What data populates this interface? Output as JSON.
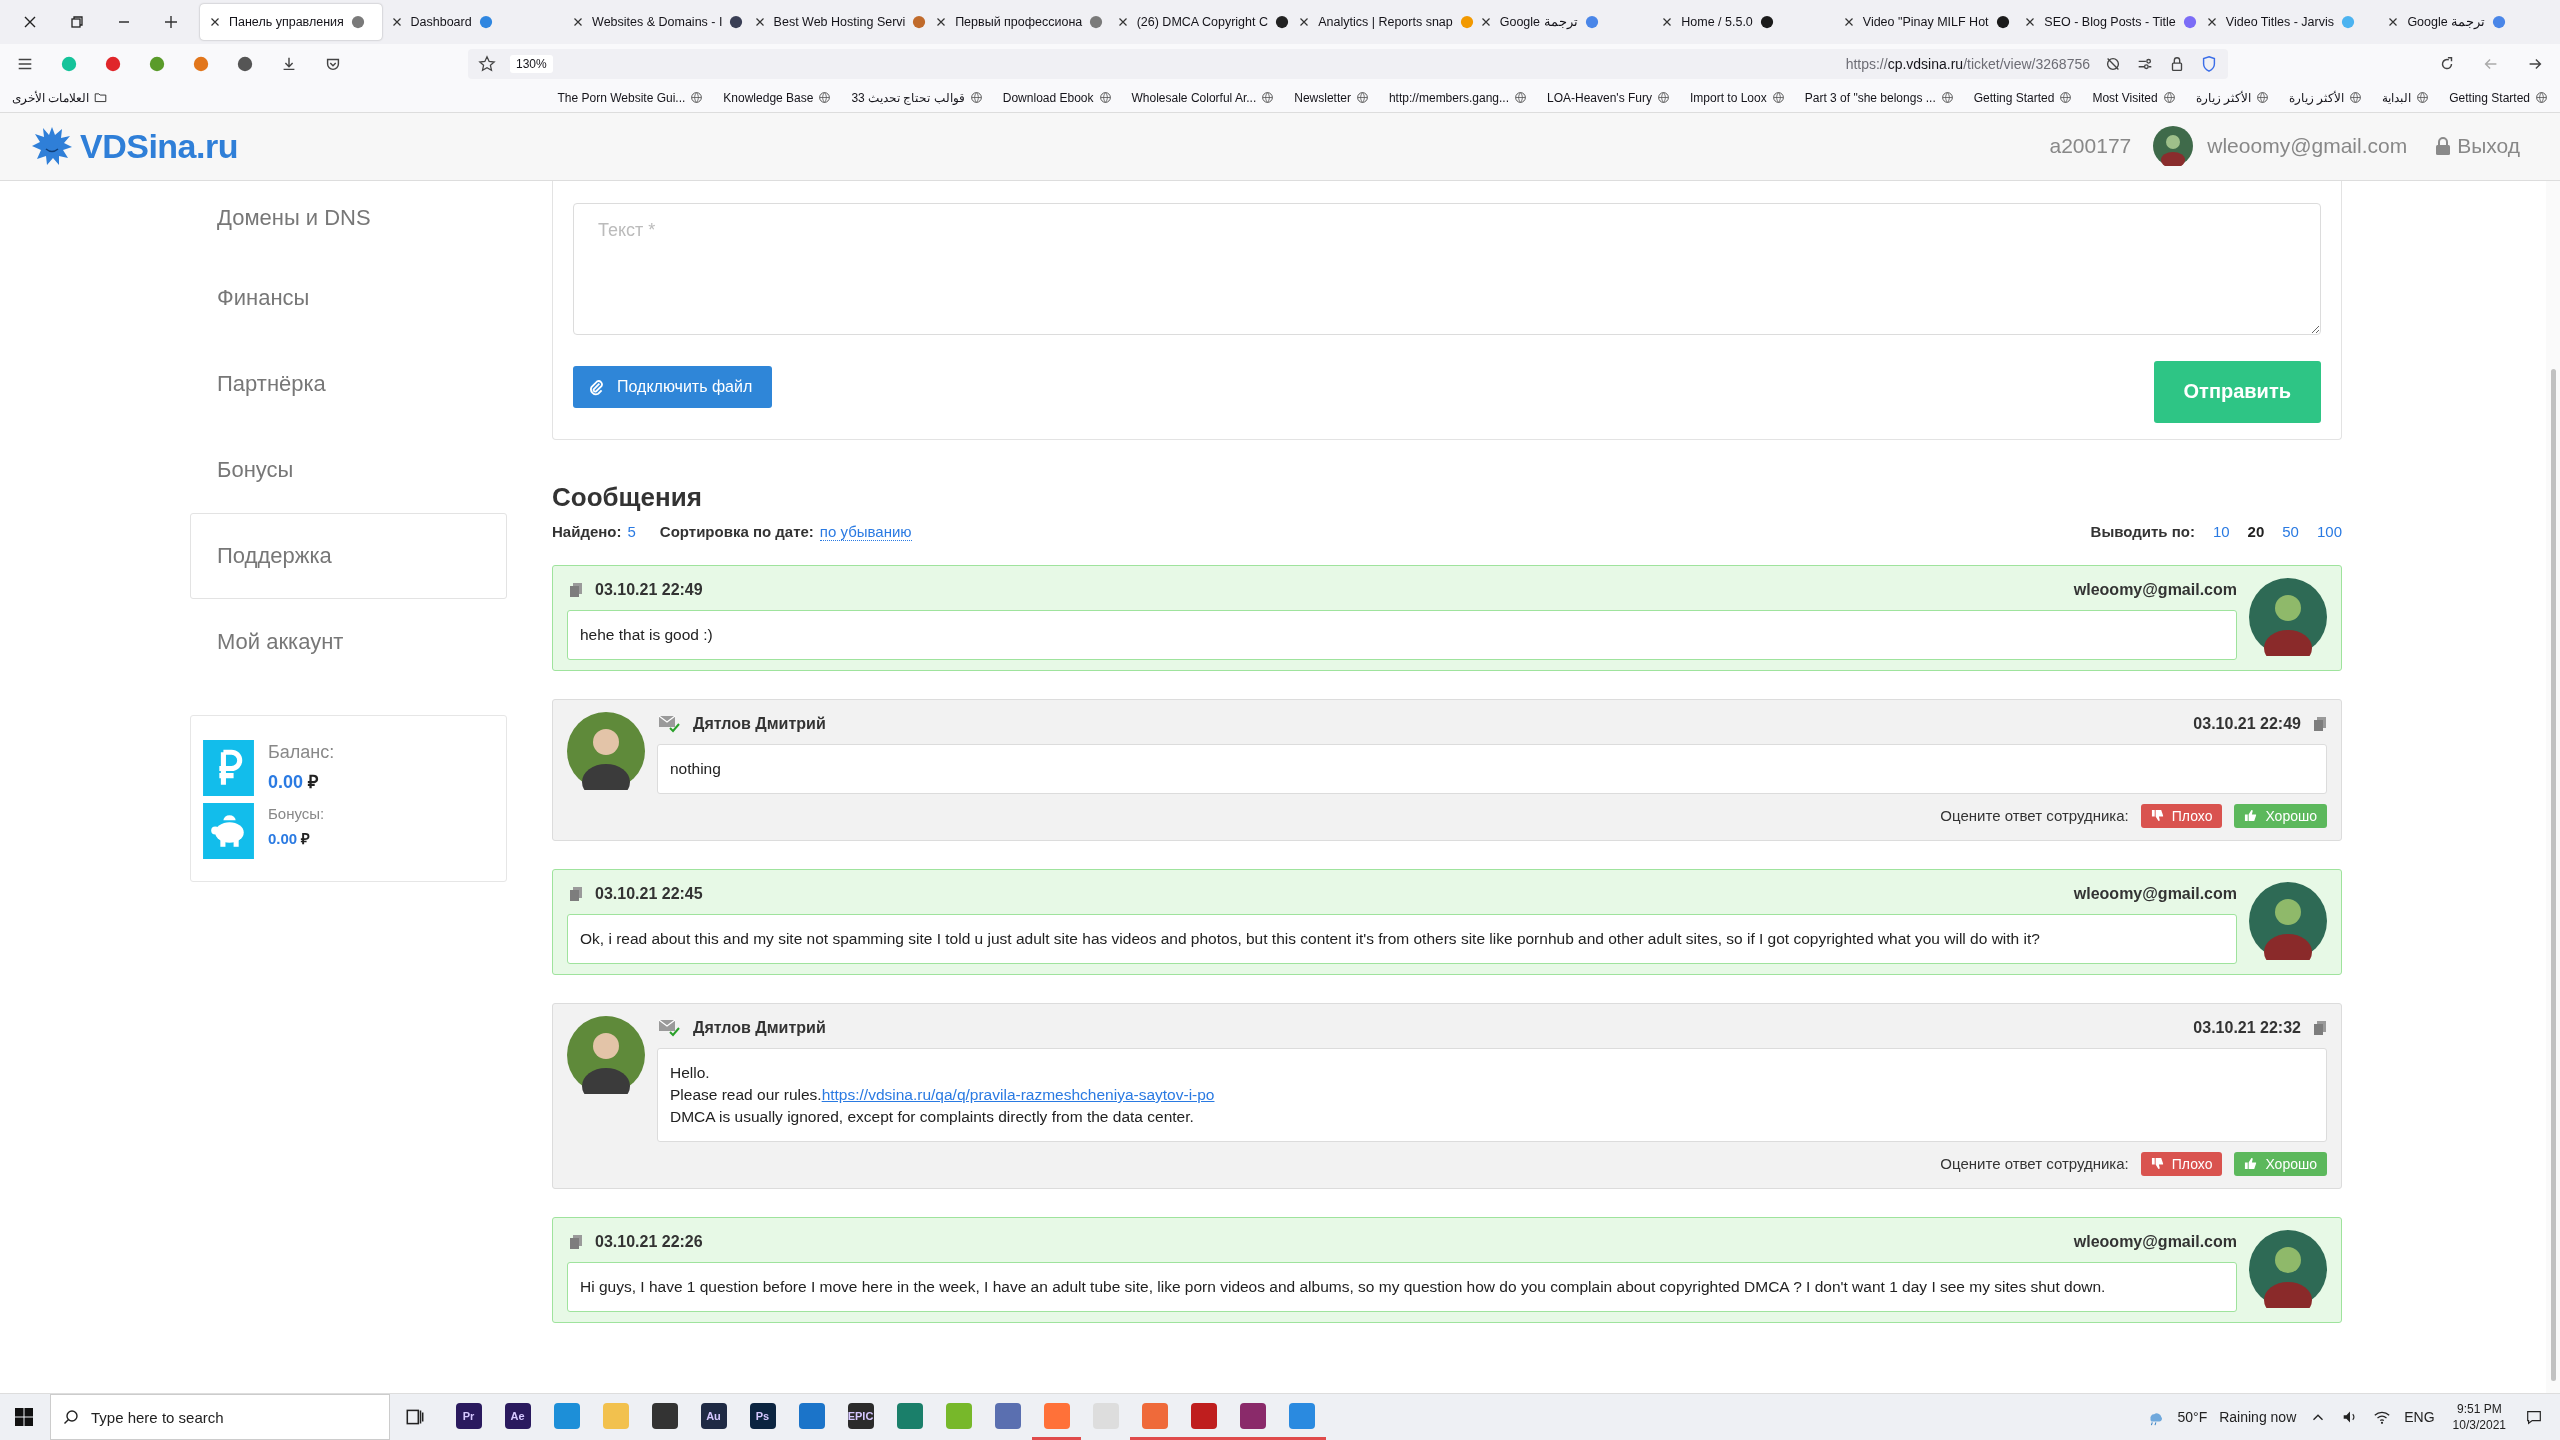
{
  "browser": {
    "tabs": [
      {
        "label": "Панель управления",
        "selected": true,
        "color": "#7a7a7a"
      },
      {
        "label": "Dashboard",
        "selected": false,
        "color": "#2f86e0"
      },
      {
        "label": "Websites & Domains - I",
        "selected": false,
        "color": "#3a3f55"
      },
      {
        "label": "Best Web Hosting Servi",
        "selected": false,
        "color": "#c06a2b"
      },
      {
        "label": "Первый профессиона",
        "selected": false,
        "color": "#7a7a7a"
      },
      {
        "label": "(26) DMCA Copyright C",
        "selected": false,
        "color": "#222222"
      },
      {
        "label": "Analytics | Reports snap",
        "selected": false,
        "color": "#f29900"
      },
      {
        "label": "Google ترجمة",
        "selected": false,
        "color": "#4a86e8"
      },
      {
        "label": "Home / 5.5.0",
        "selected": false,
        "color": "#1b1b1b"
      },
      {
        "label": "Video \"Pinay MILF Hot",
        "selected": false,
        "color": "#1b1b1b"
      },
      {
        "label": "SEO - Blog Posts - Title",
        "selected": false,
        "color": "#7b6cf6"
      },
      {
        "label": "Video Titles - Jarvis",
        "selected": false,
        "color": "#4cb3f0"
      },
      {
        "label": "Google ترجمة",
        "selected": false,
        "color": "#4a86e8"
      }
    ],
    "zoom": "130%",
    "url": "https://**cp.vdsina.ru**/ticket/view/3268756",
    "bookmarks_folder": "العلامات الأخرى",
    "bookmarks": [
      "The Porn Website Gui...",
      "Knowledge Base",
      "33 قوالب تحتاج تحديث",
      "Download Ebook",
      "Wholesale Colorful Ar...",
      "Newsletter",
      "http://members.gang...",
      "LOA-Heaven's Fury",
      "Import to Loox",
      "Part 3 of \"she belongs ...",
      "Getting Started",
      "Most Visited",
      "الأكثر زيارة",
      "الأكثر زيارة",
      "البداية",
      "Getting Started"
    ]
  },
  "header": {
    "logo": "VDSina.ru",
    "account_id": "a200177",
    "email": "wleoomy@gmail.com",
    "logout": "Выход"
  },
  "sidebar": {
    "items": [
      {
        "label": "Домены и DNS",
        "selected": false
      },
      {
        "label": "Финансы",
        "selected": false
      },
      {
        "label": "Партнёрка",
        "selected": false
      },
      {
        "label": "Бонусы",
        "selected": false
      },
      {
        "label": "Поддержка",
        "selected": true
      },
      {
        "label": "Мой аккаунт",
        "selected": false
      }
    ],
    "balance": {
      "label": "Баланс:",
      "value": "0.00",
      "currency": "₽"
    },
    "bonuses": {
      "label": "Бонусы:",
      "value": "0.00",
      "currency": "₽"
    }
  },
  "form": {
    "placeholder": "Текст *",
    "attach_button": "Подключить файл",
    "send_button": "Отправить"
  },
  "messages": {
    "title": "Сообщения",
    "found_label": "Найдено:",
    "found": "5",
    "sort_label": "Сортировка по дате:",
    "sort": "по убыванию",
    "per_page_label": "Выводить по:",
    "per_page": [
      {
        "label": "10",
        "selected": false
      },
      {
        "label": "20",
        "selected": true
      },
      {
        "label": "50",
        "selected": false
      },
      {
        "label": "100",
        "selected": false
      }
    ],
    "items": [
      {
        "kind": "client",
        "date": "03.10.21 22:49",
        "author": "wleoomy@gmail.com",
        "lines": [
          {
            "text": "hehe that is good :)"
          }
        ]
      },
      {
        "kind": "staff",
        "date": "03.10.21 22:49",
        "author": "Дятлов Дмитрий",
        "lines": [
          {
            "text": "nothing"
          }
        ],
        "rate_label": "Оцените ответ сотрудника:",
        "bad": "Плохо",
        "good": "Хорошо"
      },
      {
        "kind": "client",
        "date": "03.10.21 22:45",
        "author": "wleoomy@gmail.com",
        "lines": [
          {
            "text": "Ok, i read about this and my site not spamming site I told u just adult site has videos and photos, but this content it's from others site like pornhub and other adult sites, so if I got copyrighted what you will do with it?"
          }
        ]
      },
      {
        "kind": "staff",
        "date": "03.10.21 22:32",
        "author": "Дятлов Дмитрий",
        "lines": [
          {
            "text": "Hello."
          },
          {
            "text": "Please read our rules.",
            "link": "https://vdsina.ru/qa/q/pravila-razmeshcheniya-saytov-i-po"
          },
          {
            "text": "DMCA is usually ignored, except for complaints directly from the data center."
          }
        ],
        "rate_label": "Оцените ответ сотрудника:",
        "bad": "Плохо",
        "good": "Хорошо"
      },
      {
        "kind": "client",
        "date": "03.10.21 22:26",
        "author": "wleoomy@gmail.com",
        "lines": [
          {
            "text": "Hi guys, I have 1 question before I move here in the week, I have an adult tube site, like porn videos and albums, so my question how do you complain about copyrighted DMCA ? I don't want 1 day I see my sites shut down."
          }
        ]
      }
    ]
  },
  "taskbar": {
    "search_placeholder": "Type here to search",
    "apps": [
      {
        "label": "Pr",
        "color": "#2a1a5e",
        "active": false
      },
      {
        "label": "Ae",
        "color": "#2a1a5e",
        "active": false
      },
      {
        "color": "#1d8fd8",
        "active": false
      },
      {
        "color": "#f2c14e",
        "active": false
      },
      {
        "color": "#333333",
        "active": false
      },
      {
        "label": "Au",
        "color": "#1f2a44",
        "active": false
      },
      {
        "label": "Ps",
        "color": "#0b2440",
        "active": false
      },
      {
        "color": "#1b74c9",
        "active": false
      },
      {
        "label": "EPIC",
        "color": "#2b2b2b",
        "active": false
      },
      {
        "color": "#1a7f6a",
        "active": false
      },
      {
        "color": "#77b82a",
        "active": false
      },
      {
        "color": "#5a6fb0",
        "active": false
      },
      {
        "color": "#ff7139",
        "active": true
      },
      {
        "color": "#dddddd",
        "active": false
      },
      {
        "color": "#ef6a3a",
        "active": true
      },
      {
        "color": "#bf1e1e",
        "active": true
      },
      {
        "color": "#8a2a6a",
        "active": true
      },
      {
        "color": "#2a8ae0",
        "active": true
      }
    ],
    "weather": "50°F",
    "weather_text": "Raining now",
    "language": "ENG",
    "time": "9:51 PM",
    "date": "10/3/2021"
  }
}
